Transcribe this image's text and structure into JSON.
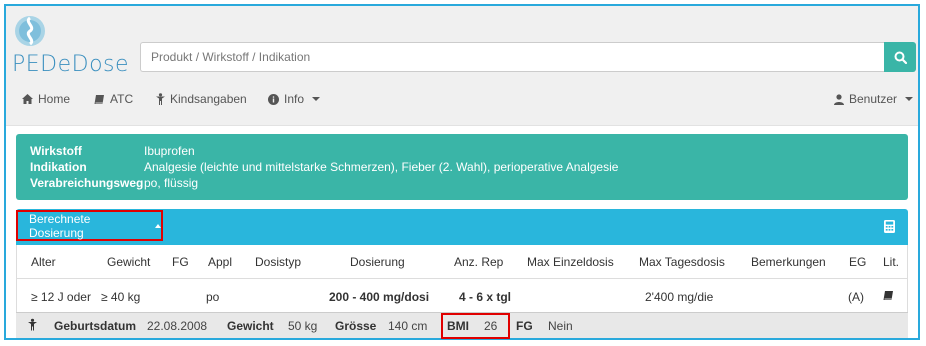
{
  "app": {
    "logo_text": "PEDeDose",
    "brand_color": "#3a8fbf",
    "accent_teal": "#3ab5a7",
    "accent_blue": "#29b6dc"
  },
  "search": {
    "placeholder": "Produkt / Wirkstoff / Indikation",
    "icon": "search-icon"
  },
  "nav": {
    "items": [
      {
        "label": "Home",
        "icon": "home-icon"
      },
      {
        "label": "ATC",
        "icon": "book-icon"
      },
      {
        "label": "Kindsangaben",
        "icon": "child-icon"
      },
      {
        "label": "Info",
        "icon": "info-icon",
        "dropdown": true
      }
    ],
    "user": {
      "label": "Benutzer",
      "icon": "user-icon",
      "dropdown": true
    }
  },
  "drug_info": {
    "rows": [
      {
        "label": "Wirkstoff",
        "value": "Ibuprofen"
      },
      {
        "label": "Indikation",
        "value": "Analgesie (leichte und mittelstarke Schmerzen), Fieber (2. Wahl), perioperative Analgesie"
      },
      {
        "label": "Verabreichungsweg",
        "value": "po, flüssig"
      }
    ]
  },
  "dosing": {
    "toggle_label": "Berechnete Dosierung",
    "calc_icon": "calculator-icon",
    "columns": [
      "Alter",
      "Gewicht",
      "FG",
      "Appl",
      "Dosistyp",
      "Dosierung",
      "Anz. Rep",
      "Max Einzeldosis",
      "Max Tagesdosis",
      "Bemerkungen",
      "EG",
      "Lit."
    ],
    "rows": [
      {
        "alter": "≥ 12 J oder",
        "gewicht": "≥ 40 kg",
        "fg": "",
        "appl": "po",
        "dosistyp": "",
        "dosierung": "200 - 400 mg/dosi",
        "anz_rep": "4 - 6 x tgl",
        "max_einzeldosis": "",
        "max_tagesdosis": "2'400 mg/die",
        "bemerkungen": "",
        "eg": "(A)",
        "lit_icon": "book-icon"
      }
    ]
  },
  "patient": {
    "icon": "child-icon",
    "geburtsdatum_label": "Geburtsdatum",
    "geburtsdatum": "22.08.2008",
    "gewicht_label": "Gewicht",
    "gewicht": "50 kg",
    "groesse_label": "Grösse",
    "groesse": "140 cm",
    "bmi_label": "BMI",
    "bmi": "26",
    "fg_label": "FG",
    "fg": "Nein"
  }
}
